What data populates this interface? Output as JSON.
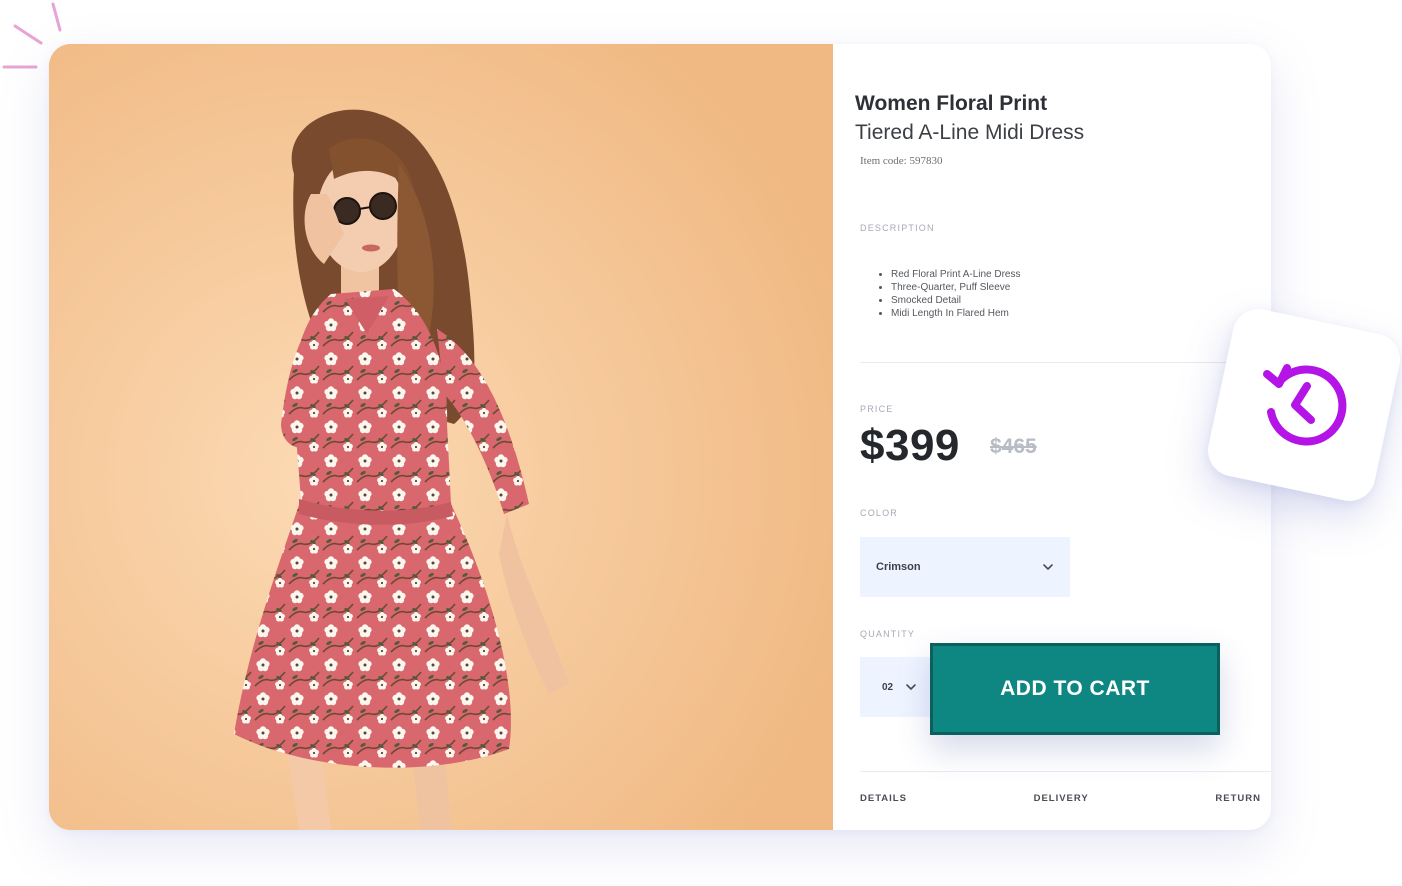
{
  "product": {
    "title_line1": "Women Floral Print",
    "title_line2": "Tiered A-Line Midi Dress",
    "item_code": "Item code: 597830"
  },
  "description": {
    "label": "DESCRIPTION",
    "items": [
      "Red Floral Print A-Line Dress",
      "Three-Quarter, Puff Sleeve",
      "Smocked Detail",
      "Midi Length In Flared Hem"
    ]
  },
  "price": {
    "label": "PRICE",
    "current": "$399",
    "original": "$465"
  },
  "color": {
    "label": "COLOR",
    "selected": "Crimson"
  },
  "quantity": {
    "label": "QUANTITY",
    "selected": "02"
  },
  "cart": {
    "button_label": "ADD TO CART"
  },
  "tabs": [
    "DETAILS",
    "DELIVERY",
    "RETURN"
  ],
  "icons": {
    "history": "history-icon",
    "chevron": "chevron-down-icon",
    "sparkle": "sparkle-icon"
  },
  "colors": {
    "cart_button": "#0e8783",
    "history_icon": "#b414e6",
    "photo_background": "#f7c897",
    "dress": "#d9696f"
  }
}
